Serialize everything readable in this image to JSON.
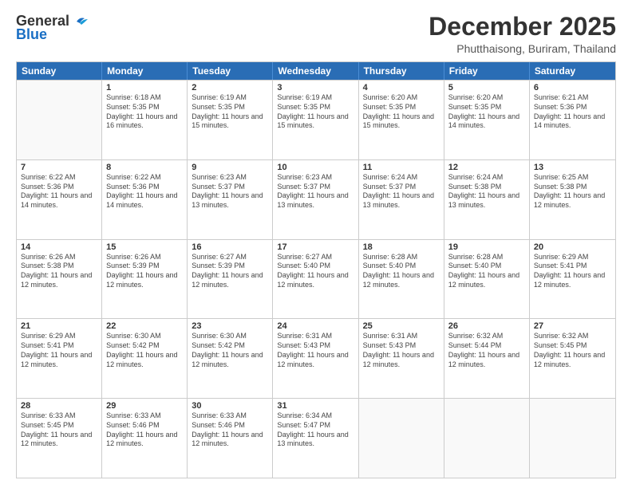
{
  "header": {
    "logo_general": "General",
    "logo_blue": "Blue",
    "month_title": "December 2025",
    "location": "Phutthaisong, Buriram, Thailand"
  },
  "days_of_week": [
    "Sunday",
    "Monday",
    "Tuesday",
    "Wednesday",
    "Thursday",
    "Friday",
    "Saturday"
  ],
  "weeks": [
    [
      {
        "day": "",
        "sunrise": "",
        "sunset": "",
        "daylight": ""
      },
      {
        "day": "1",
        "sunrise": "Sunrise: 6:18 AM",
        "sunset": "Sunset: 5:35 PM",
        "daylight": "Daylight: 11 hours and 16 minutes."
      },
      {
        "day": "2",
        "sunrise": "Sunrise: 6:19 AM",
        "sunset": "Sunset: 5:35 PM",
        "daylight": "Daylight: 11 hours and 15 minutes."
      },
      {
        "day": "3",
        "sunrise": "Sunrise: 6:19 AM",
        "sunset": "Sunset: 5:35 PM",
        "daylight": "Daylight: 11 hours and 15 minutes."
      },
      {
        "day": "4",
        "sunrise": "Sunrise: 6:20 AM",
        "sunset": "Sunset: 5:35 PM",
        "daylight": "Daylight: 11 hours and 15 minutes."
      },
      {
        "day": "5",
        "sunrise": "Sunrise: 6:20 AM",
        "sunset": "Sunset: 5:35 PM",
        "daylight": "Daylight: 11 hours and 14 minutes."
      },
      {
        "day": "6",
        "sunrise": "Sunrise: 6:21 AM",
        "sunset": "Sunset: 5:36 PM",
        "daylight": "Daylight: 11 hours and 14 minutes."
      }
    ],
    [
      {
        "day": "7",
        "sunrise": "Sunrise: 6:22 AM",
        "sunset": "Sunset: 5:36 PM",
        "daylight": "Daylight: 11 hours and 14 minutes."
      },
      {
        "day": "8",
        "sunrise": "Sunrise: 6:22 AM",
        "sunset": "Sunset: 5:36 PM",
        "daylight": "Daylight: 11 hours and 14 minutes."
      },
      {
        "day": "9",
        "sunrise": "Sunrise: 6:23 AM",
        "sunset": "Sunset: 5:37 PM",
        "daylight": "Daylight: 11 hours and 13 minutes."
      },
      {
        "day": "10",
        "sunrise": "Sunrise: 6:23 AM",
        "sunset": "Sunset: 5:37 PM",
        "daylight": "Daylight: 11 hours and 13 minutes."
      },
      {
        "day": "11",
        "sunrise": "Sunrise: 6:24 AM",
        "sunset": "Sunset: 5:37 PM",
        "daylight": "Daylight: 11 hours and 13 minutes."
      },
      {
        "day": "12",
        "sunrise": "Sunrise: 6:24 AM",
        "sunset": "Sunset: 5:38 PM",
        "daylight": "Daylight: 11 hours and 13 minutes."
      },
      {
        "day": "13",
        "sunrise": "Sunrise: 6:25 AM",
        "sunset": "Sunset: 5:38 PM",
        "daylight": "Daylight: 11 hours and 12 minutes."
      }
    ],
    [
      {
        "day": "14",
        "sunrise": "Sunrise: 6:26 AM",
        "sunset": "Sunset: 5:38 PM",
        "daylight": "Daylight: 11 hours and 12 minutes."
      },
      {
        "day": "15",
        "sunrise": "Sunrise: 6:26 AM",
        "sunset": "Sunset: 5:39 PM",
        "daylight": "Daylight: 11 hours and 12 minutes."
      },
      {
        "day": "16",
        "sunrise": "Sunrise: 6:27 AM",
        "sunset": "Sunset: 5:39 PM",
        "daylight": "Daylight: 11 hours and 12 minutes."
      },
      {
        "day": "17",
        "sunrise": "Sunrise: 6:27 AM",
        "sunset": "Sunset: 5:40 PM",
        "daylight": "Daylight: 11 hours and 12 minutes."
      },
      {
        "day": "18",
        "sunrise": "Sunrise: 6:28 AM",
        "sunset": "Sunset: 5:40 PM",
        "daylight": "Daylight: 11 hours and 12 minutes."
      },
      {
        "day": "19",
        "sunrise": "Sunrise: 6:28 AM",
        "sunset": "Sunset: 5:40 PM",
        "daylight": "Daylight: 11 hours and 12 minutes."
      },
      {
        "day": "20",
        "sunrise": "Sunrise: 6:29 AM",
        "sunset": "Sunset: 5:41 PM",
        "daylight": "Daylight: 11 hours and 12 minutes."
      }
    ],
    [
      {
        "day": "21",
        "sunrise": "Sunrise: 6:29 AM",
        "sunset": "Sunset: 5:41 PM",
        "daylight": "Daylight: 11 hours and 12 minutes."
      },
      {
        "day": "22",
        "sunrise": "Sunrise: 6:30 AM",
        "sunset": "Sunset: 5:42 PM",
        "daylight": "Daylight: 11 hours and 12 minutes."
      },
      {
        "day": "23",
        "sunrise": "Sunrise: 6:30 AM",
        "sunset": "Sunset: 5:42 PM",
        "daylight": "Daylight: 11 hours and 12 minutes."
      },
      {
        "day": "24",
        "sunrise": "Sunrise: 6:31 AM",
        "sunset": "Sunset: 5:43 PM",
        "daylight": "Daylight: 11 hours and 12 minutes."
      },
      {
        "day": "25",
        "sunrise": "Sunrise: 6:31 AM",
        "sunset": "Sunset: 5:43 PM",
        "daylight": "Daylight: 11 hours and 12 minutes."
      },
      {
        "day": "26",
        "sunrise": "Sunrise: 6:32 AM",
        "sunset": "Sunset: 5:44 PM",
        "daylight": "Daylight: 11 hours and 12 minutes."
      },
      {
        "day": "27",
        "sunrise": "Sunrise: 6:32 AM",
        "sunset": "Sunset: 5:45 PM",
        "daylight": "Daylight: 11 hours and 12 minutes."
      }
    ],
    [
      {
        "day": "28",
        "sunrise": "Sunrise: 6:33 AM",
        "sunset": "Sunset: 5:45 PM",
        "daylight": "Daylight: 11 hours and 12 minutes."
      },
      {
        "day": "29",
        "sunrise": "Sunrise: 6:33 AM",
        "sunset": "Sunset: 5:46 PM",
        "daylight": "Daylight: 11 hours and 12 minutes."
      },
      {
        "day": "30",
        "sunrise": "Sunrise: 6:33 AM",
        "sunset": "Sunset: 5:46 PM",
        "daylight": "Daylight: 11 hours and 12 minutes."
      },
      {
        "day": "31",
        "sunrise": "Sunrise: 6:34 AM",
        "sunset": "Sunset: 5:47 PM",
        "daylight": "Daylight: 11 hours and 13 minutes."
      },
      {
        "day": "",
        "sunrise": "",
        "sunset": "",
        "daylight": ""
      },
      {
        "day": "",
        "sunrise": "",
        "sunset": "",
        "daylight": ""
      },
      {
        "day": "",
        "sunrise": "",
        "sunset": "",
        "daylight": ""
      }
    ]
  ]
}
